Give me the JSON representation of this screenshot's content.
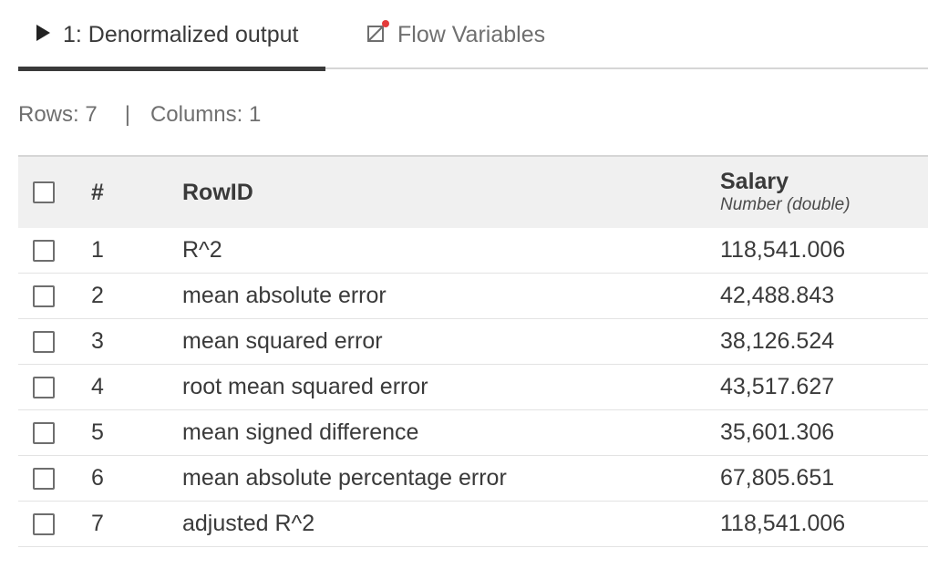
{
  "tabs": {
    "output_label": "1: Denormalized output",
    "flow_label": "Flow Variables"
  },
  "stats": {
    "rows": "Rows: 7",
    "separator": "|",
    "columns": "Columns: 1"
  },
  "table": {
    "header": {
      "num": "#",
      "rowid": "RowID",
      "value_title": "Salary",
      "value_type": "Number (double)"
    },
    "rows": [
      {
        "num": "1",
        "id": "R^2",
        "value": "118,541.006"
      },
      {
        "num": "2",
        "id": "mean absolute error",
        "value": "42,488.843"
      },
      {
        "num": "3",
        "id": "mean squared error",
        "value": "38,126.524"
      },
      {
        "num": "4",
        "id": "root mean squared error",
        "value": "43,517.627"
      },
      {
        "num": "5",
        "id": "mean signed difference",
        "value": "35,601.306"
      },
      {
        "num": "6",
        "id": "mean absolute percentage error",
        "value": "67,805.651"
      },
      {
        "num": "7",
        "id": "adjusted R^2",
        "value": "118,541.006"
      }
    ]
  },
  "icons": {
    "output_tab": "play-icon",
    "flow_tab": "flow-variables-icon"
  },
  "colors": {
    "active_tab_underline": "#3a3a3a",
    "notification_dot": "#e33b3b",
    "header_bg": "#f0f0f0"
  }
}
